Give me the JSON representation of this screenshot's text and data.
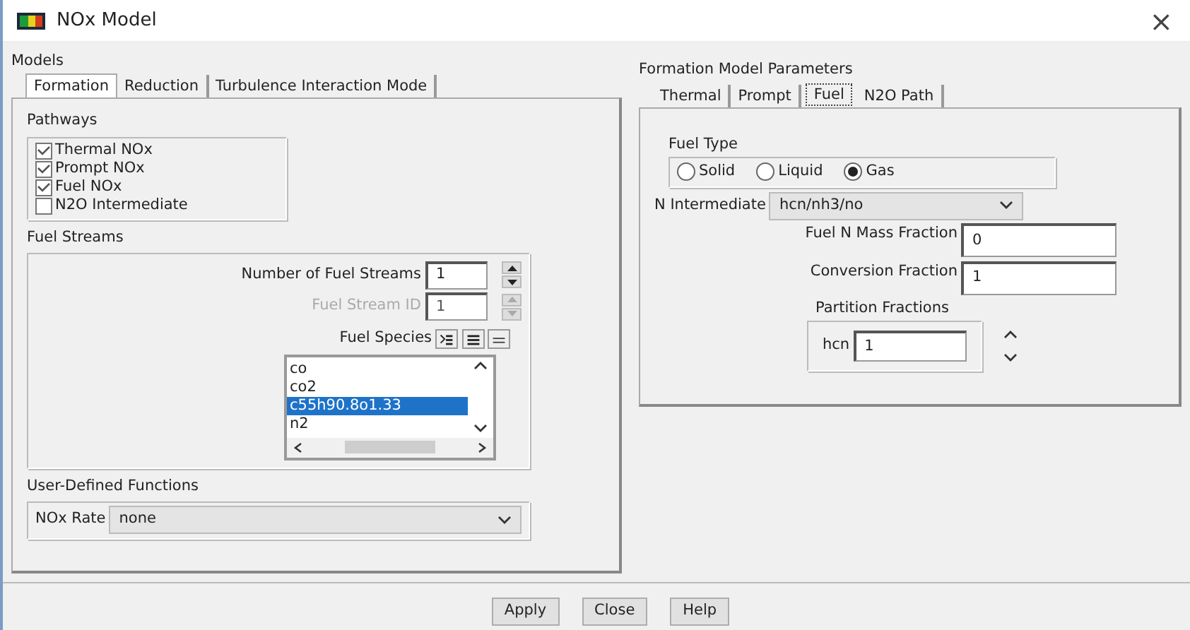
{
  "window": {
    "title": "NOx Model",
    "close": "×"
  },
  "models": {
    "label": "Models",
    "tabs": [
      {
        "label": "Formation",
        "selected": true
      },
      {
        "label": "Reduction",
        "selected": false
      },
      {
        "label": "Turbulence Interaction Mode",
        "selected": false
      }
    ],
    "pathways": {
      "label": "Pathways",
      "items": [
        {
          "label": "Thermal NOx",
          "checked": true
        },
        {
          "label": "Prompt NOx",
          "checked": true
        },
        {
          "label": "Fuel NOx",
          "checked": true
        },
        {
          "label": "N2O Intermediate",
          "checked": false
        }
      ]
    },
    "fuel_streams": {
      "label": "Fuel Streams",
      "fields": [
        {
          "label": "Number of Fuel Streams",
          "value": "1",
          "disabled": false
        },
        {
          "label": "Fuel Stream ID",
          "value": "1",
          "disabled": true
        }
      ],
      "species_label": "Fuel Species",
      "species": [
        {
          "label": "co",
          "selected": false
        },
        {
          "label": "co2",
          "selected": false
        },
        {
          "label": "c55h90.8o1.33",
          "selected": true
        },
        {
          "label": "n2",
          "selected": false
        }
      ]
    },
    "udf": {
      "label": "User-Defined Functions",
      "nox_rate_label": "NOx Rate",
      "nox_rate_value": "none"
    }
  },
  "parameters": {
    "label": "Formation Model Parameters",
    "tabs": [
      {
        "label": "Thermal",
        "selected": false
      },
      {
        "label": "Prompt",
        "selected": false
      },
      {
        "label": "Fuel",
        "selected": true
      },
      {
        "label": "N2O Path",
        "selected": false
      }
    ],
    "fuel_type": {
      "label": "Fuel Type",
      "options": [
        {
          "label": "Solid",
          "selected": false
        },
        {
          "label": "Liquid",
          "selected": false
        },
        {
          "label": "Gas",
          "selected": true
        }
      ]
    },
    "n_intermediate": {
      "label": "N Intermediate",
      "value": "hcn/nh3/no"
    },
    "fields": [
      {
        "label": "Fuel N Mass Fraction",
        "value": "0"
      },
      {
        "label": "Conversion Fraction",
        "value": "1"
      }
    ],
    "partition": {
      "label": "Partition Fractions",
      "field_label": "hcn",
      "value": "1"
    }
  },
  "buttons": [
    "Apply",
    "Close",
    "Help"
  ]
}
